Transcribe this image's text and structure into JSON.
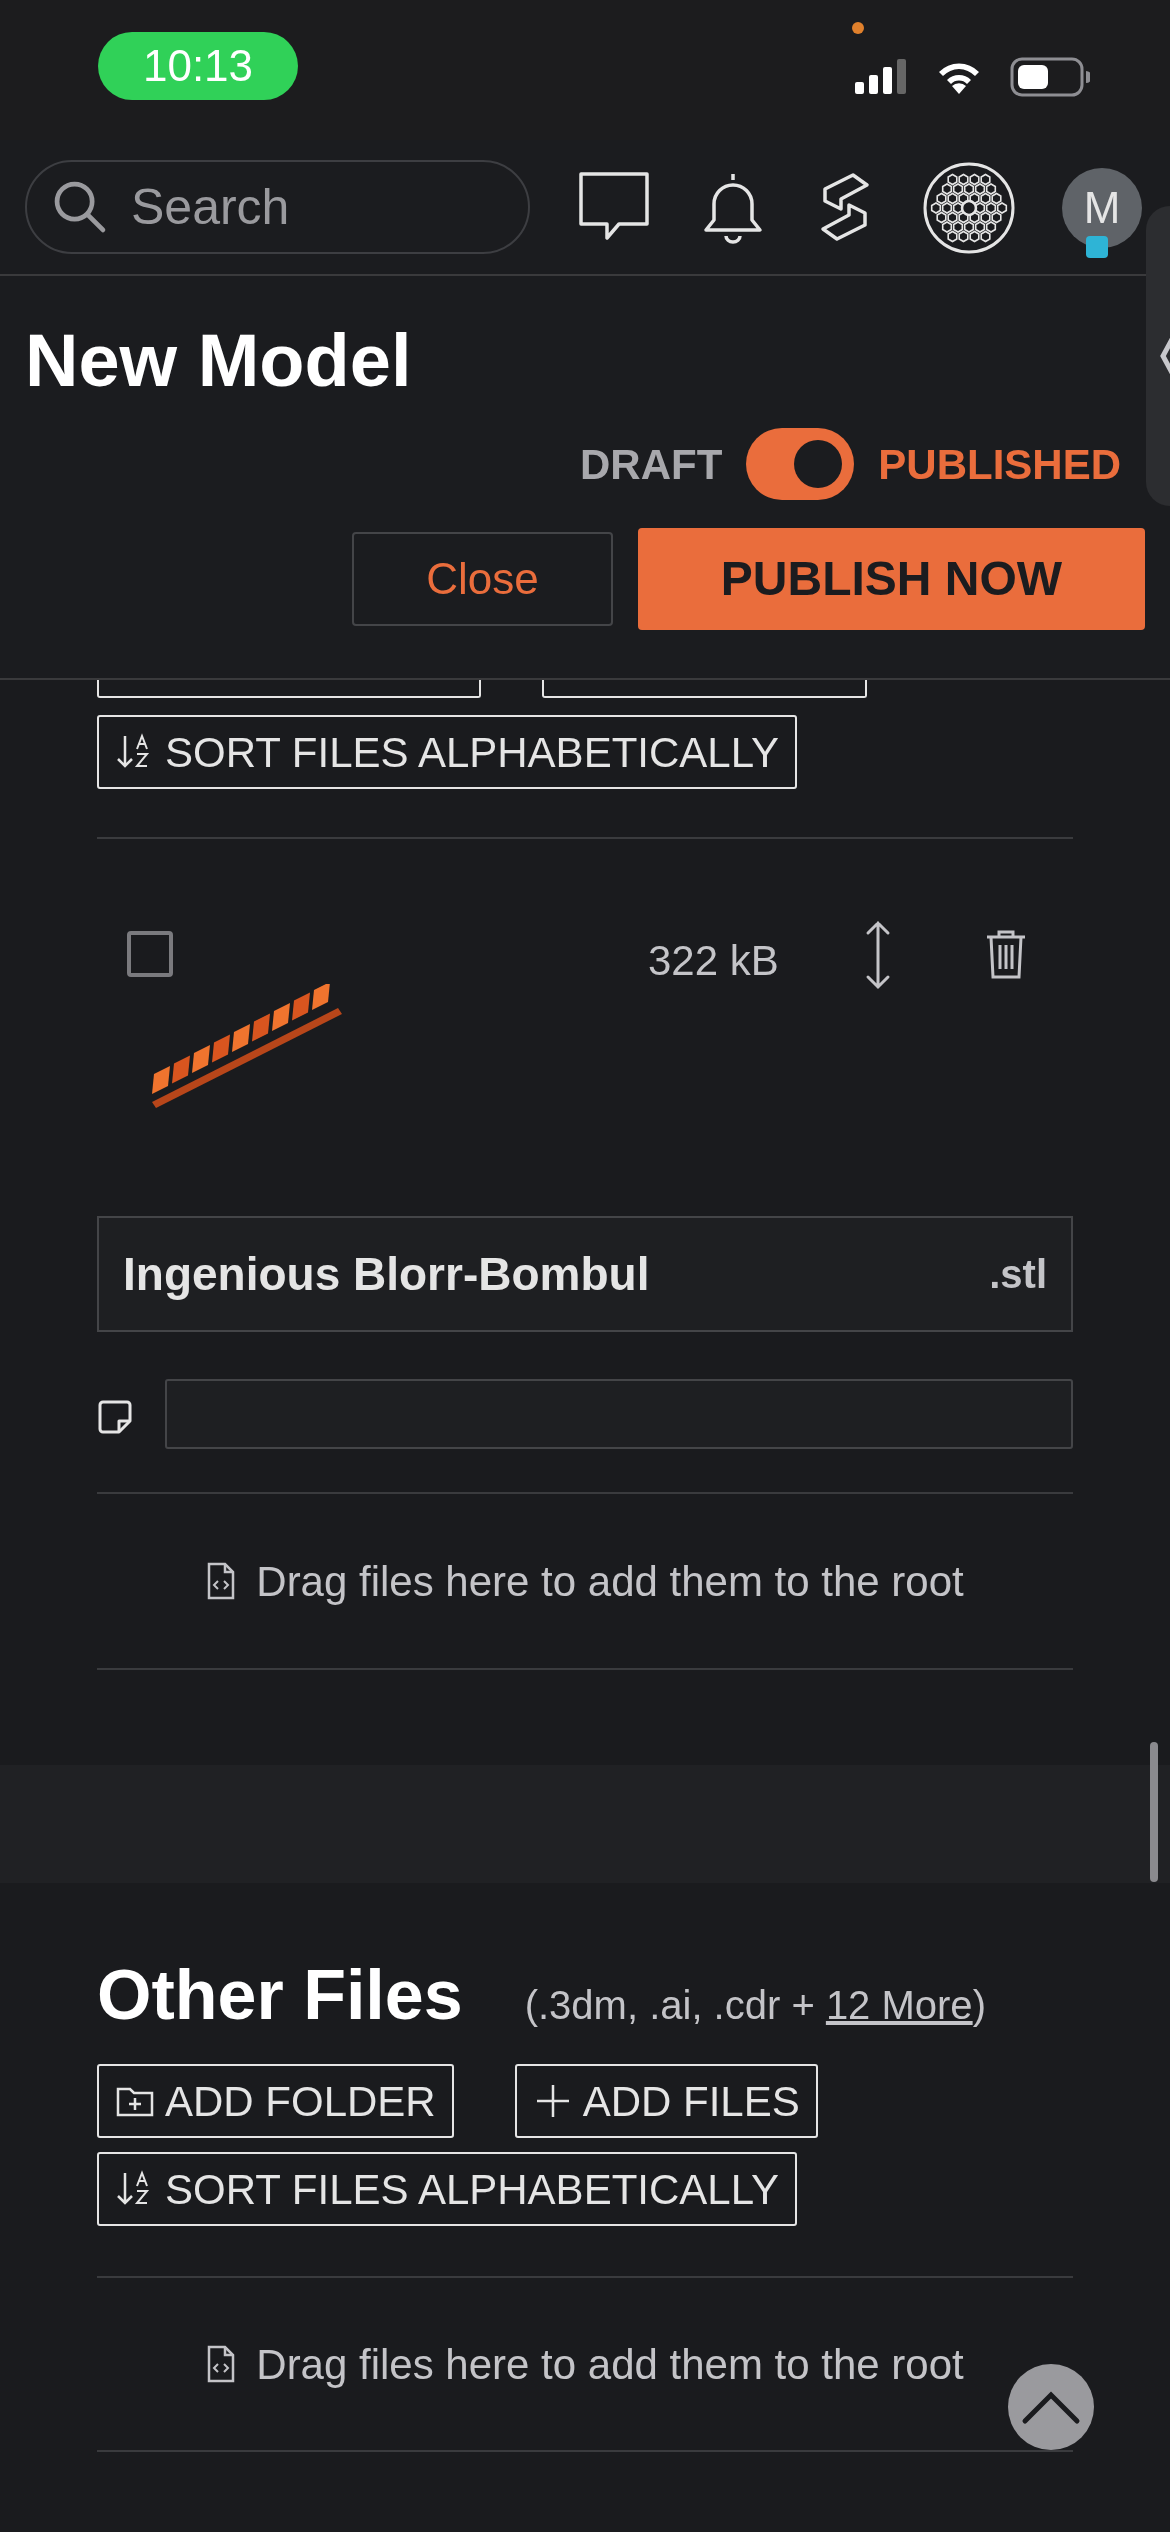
{
  "status_bar": {
    "time": "10:13"
  },
  "nav": {
    "search": {
      "placeholder": "Search"
    },
    "avatar": {
      "initial": "M"
    }
  },
  "header": {
    "title": "New Model",
    "toggle": {
      "off_label": "DRAFT",
      "on_label": "PUBLISHED",
      "on": true
    },
    "buttons": [
      {
        "label": "Close",
        "kind": "secondary"
      },
      {
        "label": "PUBLISH NOW",
        "kind": "primary"
      }
    ]
  },
  "root_files": {
    "toolbar": [
      {
        "label": "SORT FILES ALPHABETICALLY",
        "kind": "sort"
      }
    ],
    "files": [
      {
        "checked": false,
        "size": "322 kB",
        "name": "Ingenious Blorr-Bombul",
        "extension": ".stl"
      }
    ],
    "drop_hint": "Drag files here to add them to the root"
  },
  "other_files": {
    "title": "Other Files",
    "formats": "(.3dm, .ai, .cdr + ",
    "more_link": "12 More",
    "formats_end": ")",
    "toolbar": [
      {
        "label": "ADD FOLDER",
        "kind": "folder"
      },
      {
        "label": "ADD FILES",
        "kind": "add"
      },
      {
        "label": "SORT FILES ALPHABETICALLY",
        "kind": "sort"
      }
    ],
    "drop_hint": "Drag files here to add them to the root"
  }
}
